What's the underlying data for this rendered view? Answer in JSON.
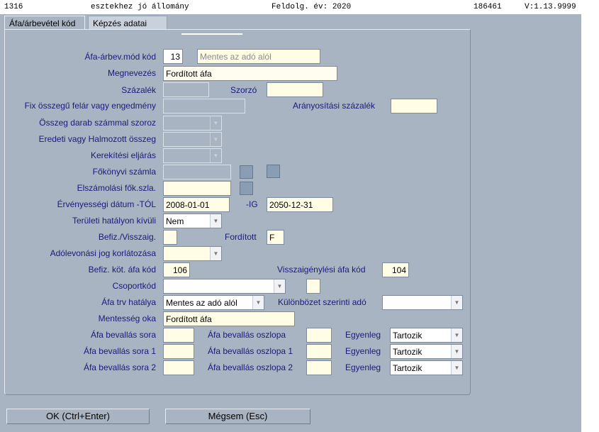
{
  "topbar": {
    "code": "1316",
    "title": "esztekhez jó állomány",
    "year": "Feldolg. év: 2020",
    "id": "186461",
    "version": "V:1.13.9999"
  },
  "tabs": [
    "Áfa/árbevétel kód",
    "Képzés adatai"
  ],
  "form": {
    "afa_kod_label": "Áfa-árbev.mód kód",
    "afa_kod_value": "13",
    "afa_kod_desc": "Mentes az adó alól",
    "megnevezes_label": "Megnevezés",
    "megnevezes_value": "Fordított áfa",
    "szazalek_label": "Százalék",
    "szorzo_label": "Szorzó",
    "fix_label": "Fix összegű felár vagy engedmény",
    "aranyositasi_label": "Arányosítási százalék",
    "osszeg_darab_label": "Összeg darab számmal szoroz",
    "eredeti_label": "Eredeti vagy Halmozott összeg",
    "kerekitesi_label": "Kerekítési eljárás",
    "fokonyvi_label": "Főkönyvi számla",
    "elszamolasi_label": "Elszámolási fők.szla.",
    "ervenyessegi_label": "Érvényességi dátum -TÓL",
    "ervenyessegi_tol": "2008-01-01",
    "ig_label": "-IG",
    "ervenyessegi_ig": "2050-12-31",
    "teruleti_label": "Területi hatályon kívüli",
    "teruleti_value": "Nem",
    "befiz_visszaig_label": "Befiz./Visszaig.",
    "forditott_label": "Fordított",
    "forditott_value": "F",
    "adolevonasi_label": "Adólevonási jog korlátozása",
    "befiz_kot_label": "Befiz. köt. áfa kód",
    "befiz_kot_value": "106",
    "visszaigenylesi_label": "Visszaigénylési áfa kód",
    "visszaigenylesi_value": "104",
    "csoportkod_label": "Csoportkód",
    "afa_trv_label": "Áfa trv hatálya",
    "afa_trv_value": "Mentes az adó alól",
    "kulonbozet_label": "Különbözet szerinti adó",
    "mentesseg_label": "Mentesség oka",
    "mentesseg_value": "Fordított áfa",
    "bev_sora_label": "Áfa bevallás sora",
    "bev_oszlopa_label": "Áfa bevallás oszlopa",
    "egyenleg_label": "Egyenleg",
    "egyenleg_value": "Tartozik",
    "bev_sora1_label": "Áfa bevallás sora 1",
    "bev_oszlopa1_label": "Áfa bevallás oszlopa 1",
    "egyenleg1_value": "Tartozik",
    "bev_sora2_label": "Áfa bevallás sora 2",
    "bev_oszlopa2_label": "Áfa bevallás oszlopa 2",
    "egyenleg2_value": "Tartozik"
  },
  "buttons": {
    "ok": "OK (Ctrl+Enter)",
    "cancel": "Mégsem (Esc)"
  },
  "icons": {
    "dropdown": "▼",
    "dropdown_icon_name": "chevron-down-icon",
    "lookup_icon_name": "lookup-button-icon"
  },
  "colors": {
    "background": "#a8b4c2",
    "field_active": "#fffde6",
    "label_text": "#1a1a7a"
  }
}
